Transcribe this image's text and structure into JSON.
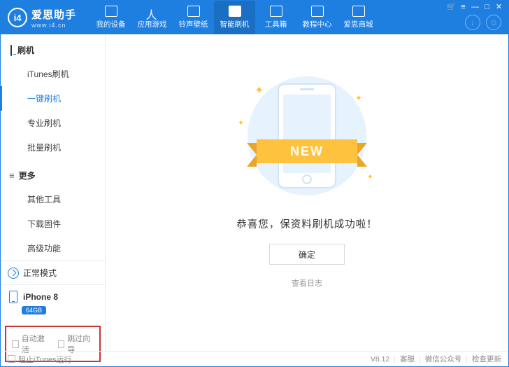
{
  "brand": {
    "name": "爱思助手",
    "url": "www.i4.cn"
  },
  "tabs": [
    {
      "label": "我的设备"
    },
    {
      "label": "应用游戏"
    },
    {
      "label": "铃声壁纸"
    },
    {
      "label": "智能刷机"
    },
    {
      "label": "工具箱"
    },
    {
      "label": "教程中心"
    },
    {
      "label": "爱思商城"
    }
  ],
  "sidebar": {
    "section_flash": {
      "title": "刷机",
      "items": [
        "iTunes刷机",
        "一键刷机",
        "专业刷机",
        "批量刷机"
      ]
    },
    "section_more": {
      "title": "更多",
      "items": [
        "其他工具",
        "下载固件",
        "高级功能"
      ]
    }
  },
  "status": {
    "mode_label": "正常模式"
  },
  "device": {
    "name": "iPhone 8",
    "storage": "64GB"
  },
  "options": {
    "auto_activate": "自动激活",
    "skip_guide": "跳过向导"
  },
  "main": {
    "ribbon": "NEW",
    "success_text": "恭喜您，保资料刷机成功啦！",
    "ok_label": "确定",
    "log_label": "查看日志"
  },
  "footer": {
    "block_itunes": "阻止iTunes运行",
    "version": "V8.12",
    "service": "客服",
    "wechat": "微信公众号",
    "update": "检查更新"
  }
}
